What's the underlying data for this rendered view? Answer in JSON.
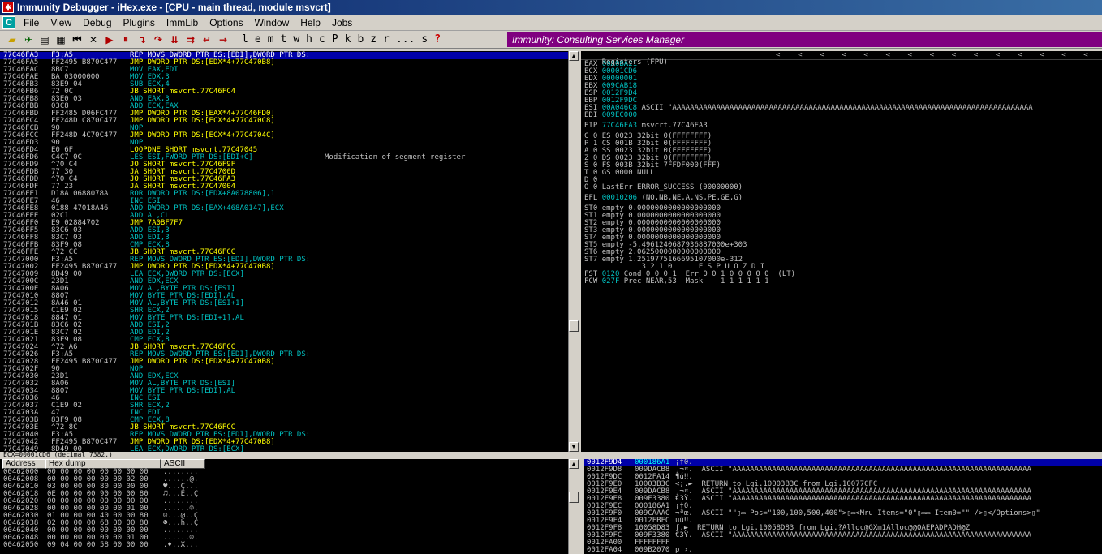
{
  "window": {
    "title": "Immunity Debugger - iHex.exe - [CPU - main thread, module msvcrt]"
  },
  "menu": [
    "File",
    "View",
    "Debug",
    "Plugins",
    "ImmLib",
    "Options",
    "Window",
    "Help",
    "Jobs"
  ],
  "toolbar": {
    "letters": [
      "l",
      "e",
      "m",
      "t",
      "w",
      "h",
      "c",
      "P",
      "k",
      "b",
      "z",
      "r",
      "...",
      "s",
      "?"
    ],
    "banner": "Immunity: Consulting Services Manager"
  },
  "disasm": [
    {
      "a": "77C46FA3",
      "h": "F3:A5",
      "d": "REP MOVS DWORD PTR ES:[EDI],DWORD PTR DS:",
      "k": "def",
      "sel": true
    },
    {
      "a": "77C46FA5",
      "h": "FF2495 B870C477",
      "d": "JMP DWORD PTR DS:[EDX*4+77C470B8]",
      "k": "jmp"
    },
    {
      "a": "77C46FAC",
      "h": "8BC7",
      "d": "MOV EAX,EDI",
      "k": "def"
    },
    {
      "a": "77C46FAE",
      "h": "BA 03000000",
      "d": "MOV EDX,3",
      "k": "def"
    },
    {
      "a": "77C46FB3",
      "h": "83E9 04",
      "d": "SUB ECX,4",
      "k": "def"
    },
    {
      "a": "77C46FB6",
      "h": "72 0C",
      "d": "JB SHORT msvcrt.77C46FC4",
      "k": "jmp"
    },
    {
      "a": "77C46FB8",
      "h": "83E0 03",
      "d": "AND EAX,3",
      "k": "def"
    },
    {
      "a": "77C46FBB",
      "h": "03C8",
      "d": "ADD ECX,EAX",
      "k": "def"
    },
    {
      "a": "77C46FBD",
      "h": "FF2485 D06FC477",
      "d": "JMP DWORD PTR DS:[EAX*4+77C46FD0]",
      "k": "jmp"
    },
    {
      "a": "77C46FC4",
      "h": "FF248D C870C477",
      "d": "JMP DWORD PTR DS:[ECX*4+77C470C8]",
      "k": "jmp"
    },
    {
      "a": "77C46FCB",
      "h": "90",
      "d": "NOP",
      "k": "def"
    },
    {
      "a": "77C46FCC",
      "h": "FF248D 4C70C477",
      "d": "JMP DWORD PTR DS:[ECX*4+77C4704C]",
      "k": "jmp"
    },
    {
      "a": "77C46FD3",
      "h": "90",
      "d": "NOP",
      "k": "def"
    },
    {
      "a": "77C46FD4",
      "h": "E0 6F",
      "d": "LOOPDNE SHORT msvcrt.77C47045",
      "k": "jmp"
    },
    {
      "a": "77C46FD6",
      "h": "C4C7 0C",
      "d": "LES ESI,FWORD PTR DS:[EDI+C]",
      "k": "def",
      "c": "Modification of segment register"
    },
    {
      "a": "77C46FD9",
      "h": "^70 C4",
      "d": "JO SHORT msvcrt.77C46F9F",
      "k": "jmp"
    },
    {
      "a": "77C46FDB",
      "h": "77 30",
      "d": "JA SHORT msvcrt.77C4700D",
      "k": "jmp"
    },
    {
      "a": "77C46FDD",
      "h": "^70 C4",
      "d": "JO SHORT msvcrt.77C46FA3",
      "k": "jmp"
    },
    {
      "a": "77C46FDF",
      "h": "77 23",
      "d": "JA SHORT msvcrt.77C47004",
      "k": "jmp"
    },
    {
      "a": "77C46FE1",
      "h": "D18A 0688078A",
      "d": "ROR DWORD PTR DS:[EDX+8A078806],1",
      "k": "def"
    },
    {
      "a": "77C46FE7",
      "h": "46",
      "d": "INC ESI",
      "k": "def"
    },
    {
      "a": "77C46FE8",
      "h": "0188 47018A46",
      "d": "ADD DWORD PTR DS:[EAX+468A0147],ECX",
      "k": "def"
    },
    {
      "a": "77C46FEE",
      "h": "02C1",
      "d": "ADD AL,CL",
      "k": "def"
    },
    {
      "a": "77C46FF0",
      "h": "E9 02884702",
      "d": "JMP 7A0BF7F7",
      "k": "jmp"
    },
    {
      "a": "77C46FF5",
      "h": "83C6 03",
      "d": "ADD ESI,3",
      "k": "def"
    },
    {
      "a": "77C46FF8",
      "h": "83C7 03",
      "d": "ADD EDI,3",
      "k": "def"
    },
    {
      "a": "77C46FFB",
      "h": "83F9 08",
      "d": "CMP ECX,8",
      "k": "def"
    },
    {
      "a": "77C46FFE",
      "h": "^72 CC",
      "d": "JB SHORT msvcrt.77C46FCC",
      "k": "jmp"
    },
    {
      "a": "77C47000",
      "h": "F3:A5",
      "d": "REP MOVS DWORD PTR ES:[EDI],DWORD PTR DS:",
      "k": "def"
    },
    {
      "a": "77C47002",
      "h": "FF2495 B870C477",
      "d": "JMP DWORD PTR DS:[EDX*4+77C470B8]",
      "k": "jmp"
    },
    {
      "a": "77C47009",
      "h": "8D49 00",
      "d": "LEA ECX,DWORD PTR DS:[ECX]",
      "k": "def"
    },
    {
      "a": "77C4700C",
      "h": "23D1",
      "d": "AND EDX,ECX",
      "k": "def"
    },
    {
      "a": "77C4700E",
      "h": "8A06",
      "d": "MOV AL,BYTE PTR DS:[ESI]",
      "k": "def"
    },
    {
      "a": "77C47010",
      "h": "8807",
      "d": "MOV BYTE PTR DS:[EDI],AL",
      "k": "def"
    },
    {
      "a": "77C47012",
      "h": "8A46 01",
      "d": "MOV AL,BYTE PTR DS:[ESI+1]",
      "k": "def"
    },
    {
      "a": "77C47015",
      "h": "C1E9 02",
      "d": "SHR ECX,2",
      "k": "def"
    },
    {
      "a": "77C47018",
      "h": "8847 01",
      "d": "MOV BYTE PTR DS:[EDI+1],AL",
      "k": "def"
    },
    {
      "a": "77C4701B",
      "h": "83C6 02",
      "d": "ADD ESI,2",
      "k": "def"
    },
    {
      "a": "77C4701E",
      "h": "83C7 02",
      "d": "ADD EDI,2",
      "k": "def"
    },
    {
      "a": "77C47021",
      "h": "83F9 08",
      "d": "CMP ECX,8",
      "k": "def"
    },
    {
      "a": "77C47024",
      "h": "^72 A6",
      "d": "JB SHORT msvcrt.77C46FCC",
      "k": "jmp"
    },
    {
      "a": "77C47026",
      "h": "F3:A5",
      "d": "REP MOVS DWORD PTR ES:[EDI],DWORD PTR DS:",
      "k": "def"
    },
    {
      "a": "77C47028",
      "h": "FF2495 B870C477",
      "d": "JMP DWORD PTR DS:[EDX*4+77C470B8]",
      "k": "jmp"
    },
    {
      "a": "77C4702F",
      "h": "90",
      "d": "NOP",
      "k": "def"
    },
    {
      "a": "77C47030",
      "h": "23D1",
      "d": "AND EDX,ECX",
      "k": "def"
    },
    {
      "a": "77C47032",
      "h": "8A06",
      "d": "MOV AL,BYTE PTR DS:[ESI]",
      "k": "def"
    },
    {
      "a": "77C47034",
      "h": "8807",
      "d": "MOV BYTE PTR DS:[EDI],AL",
      "k": "def"
    },
    {
      "a": "77C47036",
      "h": "46",
      "d": "INC ESI",
      "k": "def"
    },
    {
      "a": "77C47037",
      "h": "C1E9 02",
      "d": "SHR ECX,2",
      "k": "def"
    },
    {
      "a": "77C4703A",
      "h": "47",
      "d": "INC EDI",
      "k": "def"
    },
    {
      "a": "77C4703B",
      "h": "83F9 08",
      "d": "CMP ECX,8",
      "k": "def"
    },
    {
      "a": "77C4703E",
      "h": "^72 8C",
      "d": "JB SHORT msvcrt.77C46FCC",
      "k": "jmp"
    },
    {
      "a": "77C47040",
      "h": "F3:A5",
      "d": "REP MOVS DWORD PTR ES:[EDI],DWORD PTR DS:",
      "k": "def"
    },
    {
      "a": "77C47042",
      "h": "FF2495 B870C477",
      "d": "JMP DWORD PTR DS:[EDX*4+77C470B8]",
      "k": "jmp"
    },
    {
      "a": "77C47049",
      "h": "8D49 00",
      "d": "LEA ECX,DWORD PTR DS:[ECX]",
      "k": "def"
    }
  ],
  "registers": {
    "title": "Registers (FPU)",
    "arrows": "<    <    <    <    <    <    <    <    <    <    <    <    <    <    <    <",
    "rows": [
      {
        "n": "EAX",
        "v": "00A0BA21",
        "x": ""
      },
      {
        "n": "ECX",
        "v": "00001CD6",
        "x": ""
      },
      {
        "n": "EDX",
        "v": "00000001",
        "x": ""
      },
      {
        "n": "EBX",
        "v": "009CAB18",
        "x": ""
      },
      {
        "n": "ESP",
        "v": "0012F9D4",
        "x": ""
      },
      {
        "n": "EBP",
        "v": "0012F9DC",
        "x": ""
      },
      {
        "n": "ESI",
        "v": "00A046C8",
        "x": "ASCII \"AAAAAAAAAAAAAAAAAAAAAAAAAAAAAAAAAAAAAAAAAAAAAAAAAAAAAAAAAAAAAAAAAAAAAAAAAAAAAAAAAA"
      },
      {
        "n": "EDI",
        "v": "009EC000",
        "x": ""
      },
      {
        "n": "",
        "v": "",
        "x": ""
      },
      {
        "n": "EIP",
        "v": "77C46FA3",
        "x": "msvcrt.77C46FA3"
      },
      {
        "n": "",
        "v": "",
        "x": ""
      },
      {
        "n": "C 0",
        "v": "",
        "x": "ES 0023 32bit 0(FFFFFFFF)"
      },
      {
        "n": "P 1",
        "v": "",
        "x": "CS 001B 32bit 0(FFFFFFFF)"
      },
      {
        "n": "A 0",
        "v": "",
        "x": "SS 0023 32bit 0(FFFFFFFF)"
      },
      {
        "n": "Z 0",
        "v": "",
        "x": "DS 0023 32bit 0(FFFFFFFF)"
      },
      {
        "n": "S 0",
        "v": "",
        "x": "FS 003B 32bit 7FFDF000(FFF)"
      },
      {
        "n": "T 0",
        "v": "",
        "x": "GS 0000 NULL"
      },
      {
        "n": "D 0",
        "v": "",
        "x": ""
      },
      {
        "n": "O 0",
        "v": "",
        "x": "LastErr ERROR_SUCCESS (00000000)"
      },
      {
        "n": "",
        "v": "",
        "x": ""
      },
      {
        "n": "EFL",
        "v": "00010206",
        "x": "(NO,NB,NE,A,NS,PE,GE,G)"
      },
      {
        "n": "",
        "v": "",
        "x": ""
      },
      {
        "n": "ST0",
        "v": "",
        "x": "empty 0.0000000000000000000"
      },
      {
        "n": "ST1",
        "v": "",
        "x": "empty 0.0000000000000000000"
      },
      {
        "n": "ST2",
        "v": "",
        "x": "empty 0.0000000000000000000"
      },
      {
        "n": "ST3",
        "v": "",
        "x": "empty 0.0000000000000000000"
      },
      {
        "n": "ST4",
        "v": "",
        "x": "empty 0.0000000000000000000"
      },
      {
        "n": "ST5",
        "v": "",
        "x": "empty -5.4961240687936887000e+303"
      },
      {
        "n": "ST6",
        "v": "",
        "x": "empty 2.0625000000000000000"
      },
      {
        "n": "ST7",
        "v": "",
        "x": "empty 1.2519775166695107000e-312"
      },
      {
        "n": "",
        "v": "",
        "x": "             3 2 1 0      E S P U O Z D I"
      },
      {
        "n": "FST",
        "v": "0120",
        "x": "Cond 0 0 0 1  Err 0 0 1 0 0 0 0 0  (LT)"
      },
      {
        "n": "FCW",
        "v": "027F",
        "x": "Prec NEAR,53  Mask    1 1 1 1 1 1"
      }
    ]
  },
  "status": {
    "text": "ECX=00001CD6 (decimal 7382.)"
  },
  "dump": {
    "headers": [
      "Address",
      "Hex dump",
      "ASCII"
    ],
    "rows": [
      {
        "a": "00462000",
        "h": "00 00 00 00 00 00 00 00",
        "s": "........"
      },
      {
        "a": "00462008",
        "h": "00 00 00 00 00 00 02 00",
        "s": "......@."
      },
      {
        "a": "00462010",
        "h": "03 00 00 00 80 00 00 00",
        "s": "♥...Ç..."
      },
      {
        "a": "00462018",
        "h": "0E 00 00 00 90 00 00 80",
        "s": "♬...É..Ç"
      },
      {
        "a": "00462020",
        "h": "00 00 00 00 00 00 00 00",
        "s": "........"
      },
      {
        "a": "00462028",
        "h": "00 00 00 00 00 00 01 00",
        "s": "......☺."
      },
      {
        "a": "00462030",
        "h": "01 00 00 00 40 00 00 80",
        "s": "☺...@..Ç"
      },
      {
        "a": "00462038",
        "h": "02 00 00 00 68 00 00 80",
        "s": "☻...h..Ç"
      },
      {
        "a": "00462040",
        "h": "00 00 00 00 00 00 00 00",
        "s": "........"
      },
      {
        "a": "00462048",
        "h": "00 00 00 00 00 00 01 00",
        "s": "......☺."
      },
      {
        "a": "00462050",
        "h": "09 04 00 00 58 00 00 00",
        "s": ".♦..X..."
      }
    ]
  },
  "stack": {
    "rows": [
      {
        "a": "0012F9D4",
        "v": "000186A1",
        "c": "¡†0.",
        "sel": true
      },
      {
        "a": "0012F9D8",
        "v": "009DACB8",
        "c": "¸¬¤.  ASCII \"AAAAAAAAAAAAAAAAAAAAAAAAAAAAAAAAAAAAAAAAAAAAAAAAAAAAAAAAAAAAAAAAAAAA"
      },
      {
        "a": "0012F9DC",
        "v": "0012FA14",
        "c": "¶ú‼."
      },
      {
        "a": "0012F9E0",
        "v": "10003B3C",
        "c": "<;.►  RETURN to Lgi.10003B3C from Lgi.10077CFC"
      },
      {
        "a": "0012F9E4",
        "v": "009DACB8",
        "c": "¸¬¤.  ASCII \"AAAAAAAAAAAAAAAAAAAAAAAAAAAAAAAAAAAAAAAAAAAAAAAAAAAAAAAAAAAAAAAAAAAA"
      },
      {
        "a": "0012F9E8",
        "v": "009F3380",
        "c": "€3Ÿ.  ASCII \"AAAAAAAAAAAAAAAAAAAAAAAAAAAAAAAAAAAAAAAAAAAAAAAAAAAAAAAAAAAAAAAAAAAA"
      },
      {
        "a": "0012F9EC",
        "v": "000186A1",
        "c": "¡†0."
      },
      {
        "a": "0012F9F0",
        "v": "009CAAAC",
        "v2": "",
        "c": "¬ªœ.  ASCII \"\"▯▭ Pos=\"100,100,500,400\">▯▭<Mru Items=\"0\"▯▭▭ Item0=\"\" />▯</Options>▯\""
      },
      {
        "a": "0012F9F4",
        "v": "0012FBFC",
        "c": "üû‼."
      },
      {
        "a": "0012F9F8",
        "v": "10058D83",
        "c": "ƒ.►  RETURN to Lgi.10058D83 from Lgi.?Alloc@GXm1Alloc@@QAEPADPADH@Z"
      },
      {
        "a": "0012F9FC",
        "v": "009F3380",
        "c": "€3Ÿ.  ASCII \"AAAAAAAAAAAAAAAAAAAAAAAAAAAAAAAAAAAAAAAAAAAAAAAAAAAAAAAAAAAAAAAAAAAA"
      },
      {
        "a": "0012FA00",
        "v": "FFFFFFFF",
        "c": ""
      },
      {
        "a": "0012FA04",
        "v": "009B2070",
        "c": "p ›."
      }
    ]
  },
  "colors": {
    "banner": "#800080",
    "selection": "#0000a8",
    "jump": "#ffff00",
    "default": "#00c0c0"
  }
}
